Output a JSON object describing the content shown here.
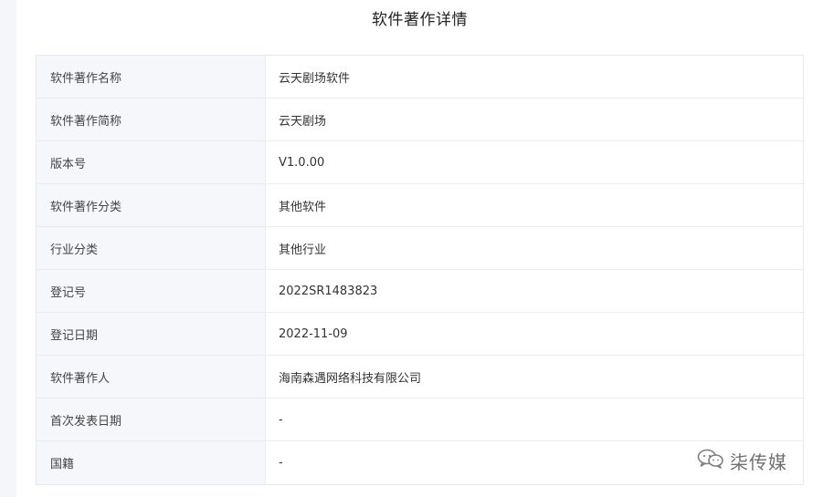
{
  "title": "软件著作详情",
  "rows": [
    {
      "label": "软件著作名称",
      "value": "云天剧场软件"
    },
    {
      "label": "软件著作简称",
      "value": "云天剧场"
    },
    {
      "label": "版本号",
      "value": "V1.0.00"
    },
    {
      "label": "软件著作分类",
      "value": "其他软件"
    },
    {
      "label": "行业分类",
      "value": "其他行业"
    },
    {
      "label": "登记号",
      "value": "2022SR1483823"
    },
    {
      "label": "登记日期",
      "value": "2022-11-09"
    },
    {
      "label": "软件著作人",
      "value": "海南森遇网络科技有限公司"
    },
    {
      "label": "首次发表日期",
      "value": "-"
    },
    {
      "label": "国籍",
      "value": "-"
    }
  ],
  "watermark": {
    "text": "柒传媒",
    "icon": "wechat-icon"
  }
}
